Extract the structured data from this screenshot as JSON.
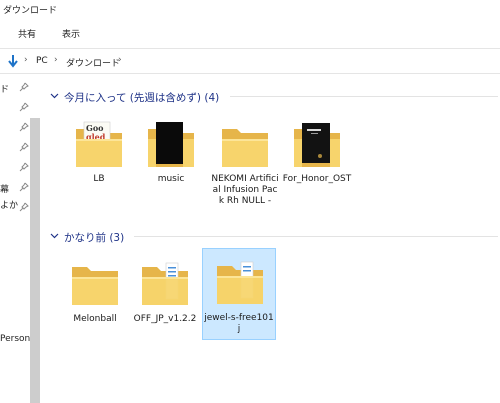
{
  "window": {
    "title": "ダウンロード"
  },
  "ribbon": {
    "tabs": [
      "共有",
      "表示"
    ]
  },
  "address": {
    "crumbs": [
      "PC",
      "ダウンロード"
    ],
    "sep": "›"
  },
  "nav": {
    "fragments": [
      "ド",
      "幕",
      "よか",
      "Person"
    ]
  },
  "groups": [
    {
      "label": "今月に入って (先週は含めず) (4)"
    },
    {
      "label": "かなり前 (3)"
    }
  ],
  "items": [
    {
      "name": "LB",
      "thumb": "book"
    },
    {
      "name": "music",
      "thumb": "black"
    },
    {
      "name": "NEKOMI Artificial Infusion Pack Rh NULL -",
      "thumb": "none"
    },
    {
      "name": "For_Honor_OST",
      "thumb": "dark"
    },
    {
      "name": "Melonball",
      "thumb": "none"
    },
    {
      "name": "OFF_JP_v1.2.2",
      "thumb": "file"
    },
    {
      "name": "jewel-s-free101j",
      "thumb": "file"
    }
  ],
  "colors": {
    "accent": "#1e3287",
    "selection": "#cce8ff",
    "folder": "#f4c95a"
  }
}
